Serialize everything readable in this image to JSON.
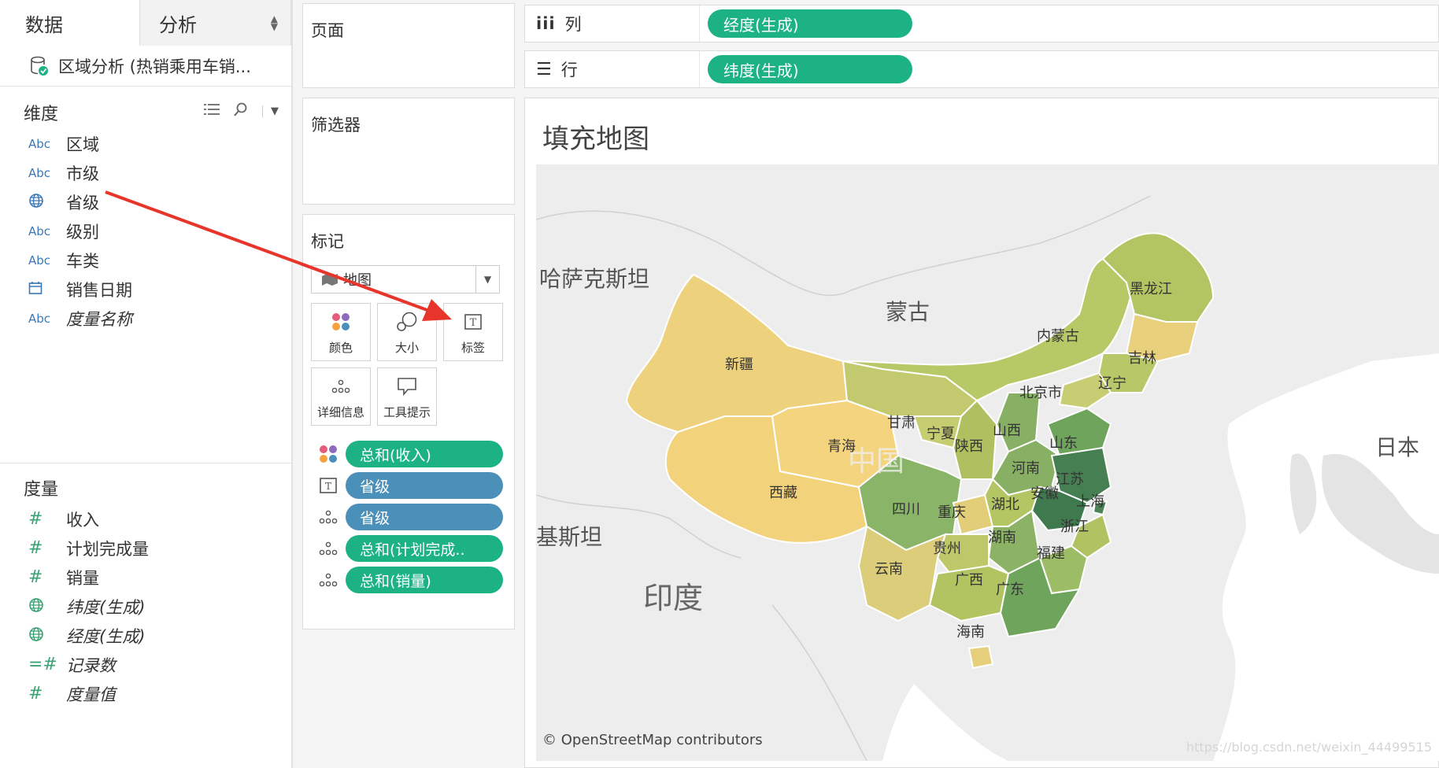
{
  "data_pane": {
    "tabs": [
      {
        "label": "数据"
      },
      {
        "label": "分析"
      }
    ],
    "datasource": "区域分析 (热销乘用车销...",
    "dimensions": {
      "title": "维度",
      "items": [
        {
          "type": "Abc",
          "label": "区域"
        },
        {
          "type": "Abc",
          "label": "市级"
        },
        {
          "type": "geo",
          "label": "省级"
        },
        {
          "type": "Abc",
          "label": "级别"
        },
        {
          "type": "Abc",
          "label": "车类"
        },
        {
          "type": "date",
          "label": "销售日期"
        },
        {
          "type": "Abc",
          "label": "度量名称"
        }
      ]
    },
    "measures": {
      "title": "度量",
      "items": [
        {
          "type": "#",
          "label": "收入"
        },
        {
          "type": "#",
          "label": "计划完成量"
        },
        {
          "type": "#",
          "label": "销量"
        },
        {
          "type": "geo",
          "label": "纬度(生成)"
        },
        {
          "type": "geo",
          "label": "经度(生成)"
        },
        {
          "type": "=#",
          "label": "记录数"
        },
        {
          "type": "#",
          "label": "度量值"
        }
      ]
    }
  },
  "pages": {
    "title": "页面"
  },
  "filters": {
    "title": "筛选器"
  },
  "marks": {
    "title": "标记",
    "mark_type": "地图",
    "buttons": [
      {
        "label": "颜色"
      },
      {
        "label": "大小"
      },
      {
        "label": "标签"
      },
      {
        "label": "详细信息"
      },
      {
        "label": "工具提示"
      }
    ],
    "pills": [
      {
        "icon": "color",
        "label": "总和(收入)",
        "color": "#1cb283"
      },
      {
        "icon": "label",
        "label": "省级",
        "color": "#4a90b8"
      },
      {
        "icon": "detail",
        "label": "省级",
        "color": "#4a90b8"
      },
      {
        "icon": "detail",
        "label": "总和(计划完成..",
        "color": "#1cb283"
      },
      {
        "icon": "detail",
        "label": "总和(销量)",
        "color": "#1cb283"
      }
    ]
  },
  "shelves": {
    "columns": {
      "icon": "iii",
      "label": "列",
      "pill": "经度(生成)"
    },
    "rows": {
      "icon": "☰",
      "label": "行",
      "pill": "纬度(生成)"
    }
  },
  "view": {
    "title": "填充地图",
    "countries": [
      "哈萨克斯坦",
      "蒙古",
      "日本",
      "印度",
      "基斯坦",
      "中国"
    ],
    "provinces": [
      "新疆",
      "西藏",
      "青海",
      "甘肃",
      "内蒙古",
      "黑龙江",
      "吉林",
      "辽宁",
      "北京市",
      "宁夏",
      "陕西",
      "山西",
      "山东",
      "河南",
      "江苏",
      "安徽",
      "上海",
      "四川",
      "重庆",
      "湖北",
      "浙江",
      "湖南",
      "贵州",
      "云南",
      "广西",
      "广东",
      "福建",
      "海南"
    ],
    "attribution": "© OpenStreetMap contributors",
    "watermark": "https://blog.csdn.net/weixin_44499515"
  },
  "colors": {
    "pill_green": "#1cb283",
    "pill_blue": "#4a90b8",
    "arrow": "#e8352b",
    "scale_low": "#f4d37e",
    "scale_high": "#3f7a4e"
  }
}
